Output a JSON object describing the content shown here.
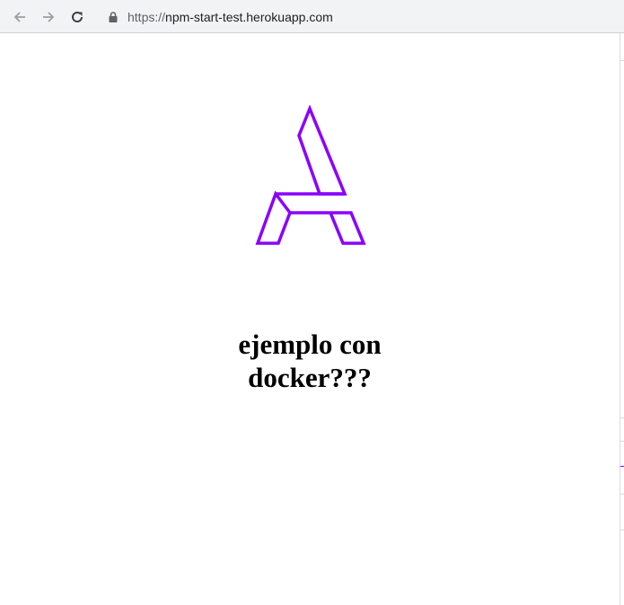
{
  "browser": {
    "url_scheme": "https://",
    "url_host": "npm-start-test.herokuapp.com",
    "icons": {
      "back": "back-arrow-icon",
      "forward": "forward-arrow-icon",
      "reload": "reload-icon",
      "secure": "lock-icon"
    }
  },
  "page": {
    "logo": {
      "icon": "astro-logo-icon",
      "stroke_color": "#8a00ff"
    },
    "heading_line1": "ejemplo con",
    "heading_line2": "docker???"
  }
}
